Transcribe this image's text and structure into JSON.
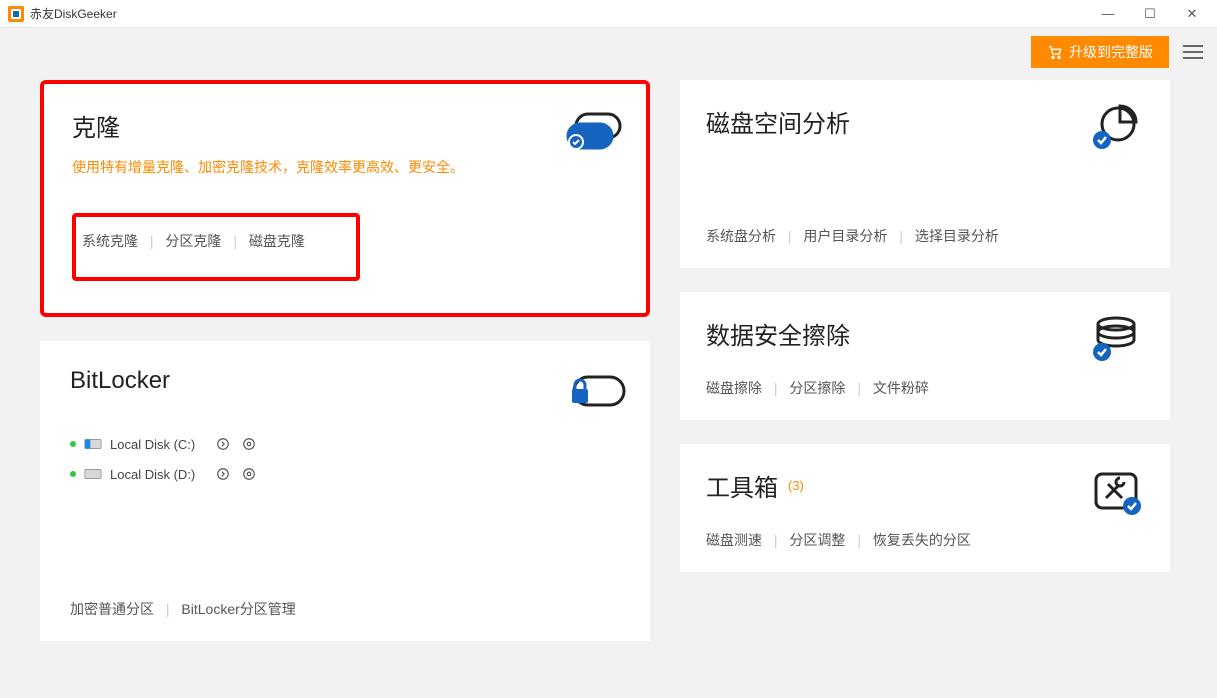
{
  "app": {
    "title": "赤友DiskGeeker"
  },
  "topbar": {
    "upgrade_label": "升级到完整版"
  },
  "cards": {
    "clone": {
      "title": "克隆",
      "subtitle": "使用特有增量克隆、加密克隆技术，克隆效率更高效、更安全。",
      "links": [
        "系统克隆",
        "分区克隆",
        "磁盘克隆"
      ]
    },
    "space": {
      "title": "磁盘空间分析",
      "links": [
        "系统盘分析",
        "用户目录分析",
        "选择目录分析"
      ]
    },
    "bitlocker": {
      "title": "BitLocker",
      "disks": [
        {
          "label": "Local Disk (C:)"
        },
        {
          "label": "Local Disk (D:)"
        }
      ],
      "links": [
        "加密普通分区",
        "BitLocker分区管理"
      ]
    },
    "erase": {
      "title": "数据安全擦除",
      "links": [
        "磁盘擦除",
        "分区擦除",
        "文件粉碎"
      ]
    },
    "toolbox": {
      "title": "工具箱",
      "badge": "(3)",
      "links": [
        "磁盘测速",
        "分区调整",
        "恢复丢失的分区"
      ]
    }
  }
}
